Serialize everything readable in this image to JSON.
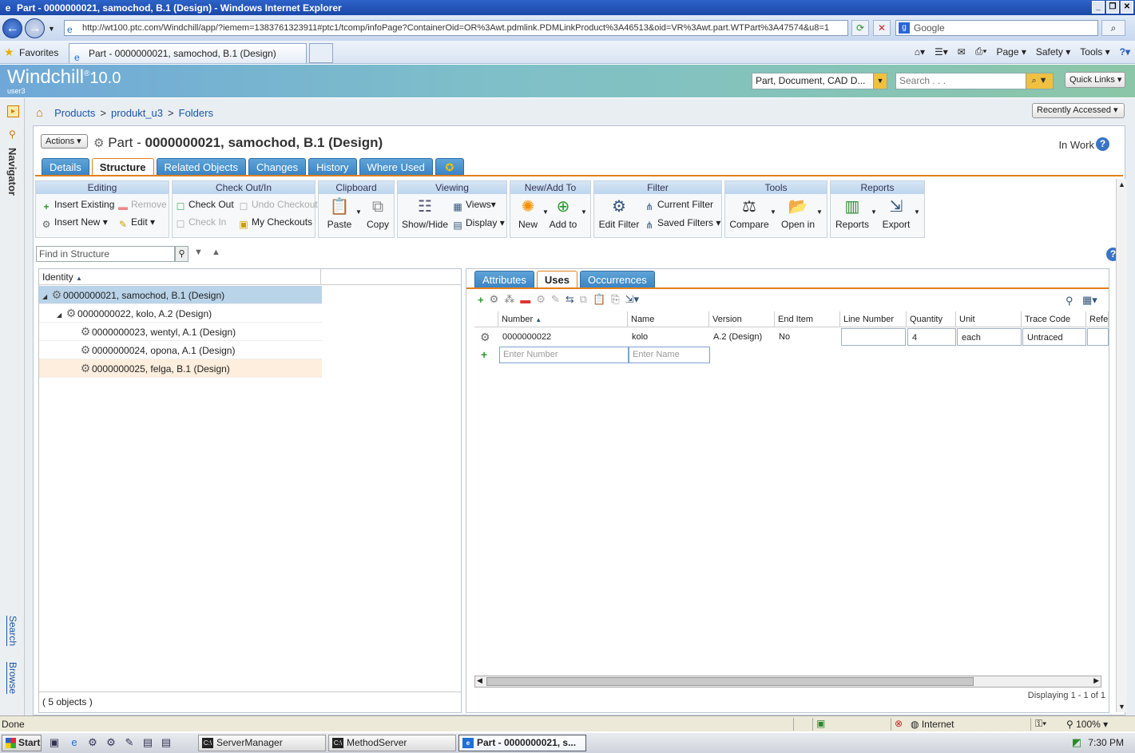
{
  "browser": {
    "title": "Part - 0000000021, samochod, B.1 (Design) - Windows Internet Explorer",
    "url": "http://wt100.ptc.com/Windchill/app/?iemem=1383761323911#ptc1/tcomp/infoPage?ContainerOid=OR%3Awt.pdmlink.PDMLinkProduct%3A46513&oid=VR%3Awt.part.WTPart%3A47574&u8=1",
    "search_placeholder": "Google",
    "favorites_label": "Favorites",
    "tab_title": "Part - 0000000021, samochod, B.1 (Design)",
    "cmd_page": "Page",
    "cmd_safety": "Safety",
    "cmd_tools": "Tools"
  },
  "app": {
    "logo": "Windchill",
    "logo_reg": "®",
    "version": "10.0",
    "user": "user3",
    "type_selector": "Part, Document, CAD D...",
    "search_placeholder": "Search . . .",
    "quick_links": "Quick Links"
  },
  "navigator": {
    "label": "Navigator",
    "search_link": "Search",
    "browse_link": "Browse"
  },
  "breadcrumb": [
    "Products",
    "produkt_u3",
    "Folders"
  ],
  "breadcrumb_sep": ">",
  "recently_accessed": "Recently Accessed",
  "page": {
    "actions_label": "Actions",
    "title_prefix": "Part - ",
    "title_main": "0000000021, samochod, B.1 (Design)",
    "state": "In Work"
  },
  "tabs": [
    "Details",
    "Structure",
    "Related Objects",
    "Changes",
    "History",
    "Where Used"
  ],
  "toolbar": {
    "editing": {
      "header": "Editing",
      "insert_existing": "Insert Existing",
      "remove": "Remove",
      "insert_new": "Insert New",
      "edit": "Edit"
    },
    "checkout": {
      "header": "Check Out/In",
      "check_out": "Check Out",
      "undo_checkout": "Undo Checkout",
      "check_in": "Check In",
      "my_checkouts": "My Checkouts"
    },
    "clipboard": {
      "header": "Clipboard",
      "paste": "Paste",
      "copy": "Copy"
    },
    "viewing": {
      "header": "Viewing",
      "show_hide": "Show/Hide",
      "views": "Views",
      "display": "Display"
    },
    "newadd": {
      "header": "New/Add To",
      "new": "New",
      "add_to": "Add to"
    },
    "filter": {
      "header": "Filter",
      "edit_filter": "Edit Filter",
      "current_filter": "Current Filter",
      "saved_filters": "Saved Filters"
    },
    "tools": {
      "header": "Tools",
      "compare": "Compare",
      "open_in": "Open in"
    },
    "reports": {
      "header": "Reports",
      "reports": "Reports",
      "export": "Export"
    }
  },
  "find": {
    "placeholder": "Find in Structure"
  },
  "tree": {
    "column": "Identity",
    "rows": [
      {
        "label": "0000000021, samochod, B.1 (Design)",
        "level": 0
      },
      {
        "label": "0000000022, kolo, A.2 (Design)",
        "level": 1
      },
      {
        "label": "0000000023, wentyl, A.1 (Design)",
        "level": 2
      },
      {
        "label": "0000000024, opona, A.1 (Design)",
        "level": 2
      },
      {
        "label": "0000000025, felga, B.1 (Design)",
        "level": 2
      }
    ],
    "footer": "( 5 objects )"
  },
  "right_tabs": [
    "Attributes",
    "Uses",
    "Occurrences"
  ],
  "uses_table": {
    "columns": [
      "Number",
      "Name",
      "Version",
      "End Item",
      "Line Number",
      "Quantity",
      "Unit",
      "Trace Code",
      "Refe"
    ],
    "row": {
      "number": "0000000022",
      "name": "kolo",
      "version": "A.2 (Design)",
      "end_item": "No",
      "line_number": "",
      "quantity": "4",
      "unit": "each",
      "trace_code": "Untraced"
    },
    "enter_number": "Enter Number",
    "enter_name": "Enter Name",
    "displaying": "Displaying 1 - 1 of 1"
  },
  "status": {
    "done": "Done",
    "zone": "Internet",
    "zoom": "100%"
  },
  "taskbar": {
    "start": "Start",
    "tasks": [
      "ServerManager",
      "MethodServer",
      "Part - 0000000021, s..."
    ],
    "clock": "7:30 PM"
  }
}
